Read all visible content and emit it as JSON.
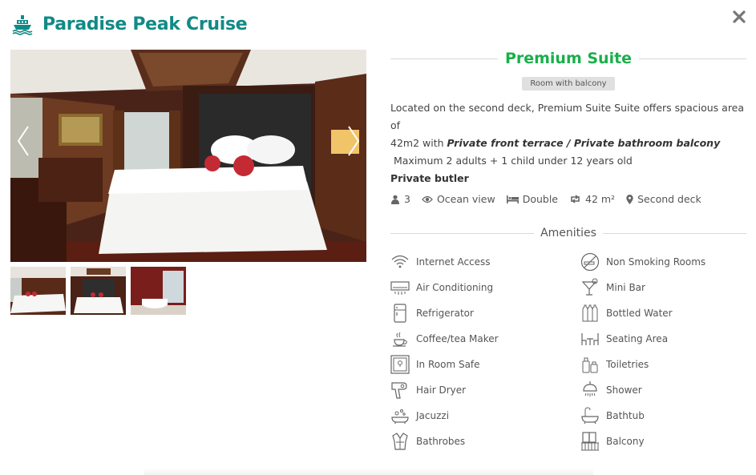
{
  "header": {
    "title": "Paradise Peak Cruise",
    "logo_icon": "cruise-ship-icon",
    "close_icon": "close-icon"
  },
  "gallery": {
    "main_alt": "Premium Suite bedroom",
    "thumbnails": [
      "bedroom-wide",
      "bedroom-center",
      "bathroom-tub"
    ]
  },
  "room": {
    "name": "Premium Suite",
    "badge": "Room with balcony",
    "desc_line1": "Located on the second deck, Premium Suite Suite offers spacious area of",
    "desc_line2_pre": "42m2 with ",
    "desc_line2_em": "Private front terrace / Private bathroom balcony",
    "desc_line3": " Maximum 2 adults + 1 child under 12 years old",
    "butler": "Private butler"
  },
  "specs": {
    "guests": "3",
    "view": "Ocean view",
    "bed": "Double",
    "area": "42 m²",
    "deck": "Second deck"
  },
  "amenities": {
    "title": "Amenities",
    "items": [
      {
        "label": "Internet Access",
        "icon": "wifi-icon"
      },
      {
        "label": "Non Smoking Rooms",
        "icon": "no-smoking-icon"
      },
      {
        "label": "Air Conditioning",
        "icon": "air-conditioner-icon"
      },
      {
        "label": "Mini Bar",
        "icon": "cocktail-icon"
      },
      {
        "label": "Refrigerator",
        "icon": "refrigerator-icon"
      },
      {
        "label": "Bottled Water",
        "icon": "bottles-icon"
      },
      {
        "label": "Coffee/tea Maker",
        "icon": "coffee-cup-icon"
      },
      {
        "label": "Seating Area",
        "icon": "seating-icon"
      },
      {
        "label": "In Room Safe",
        "icon": "safe-icon"
      },
      {
        "label": "Toiletries",
        "icon": "toiletries-icon"
      },
      {
        "label": "Hair Dryer",
        "icon": "hair-dryer-icon"
      },
      {
        "label": "Shower",
        "icon": "shower-icon"
      },
      {
        "label": "Jacuzzi",
        "icon": "jacuzzi-icon"
      },
      {
        "label": "Bathtub",
        "icon": "bathtub-icon"
      },
      {
        "label": "Bathrobes",
        "icon": "bathrobe-icon"
      },
      {
        "label": "Balcony",
        "icon": "balcony-icon"
      }
    ]
  },
  "colors": {
    "brand": "#118a86",
    "room_title": "#1aaf4b"
  }
}
